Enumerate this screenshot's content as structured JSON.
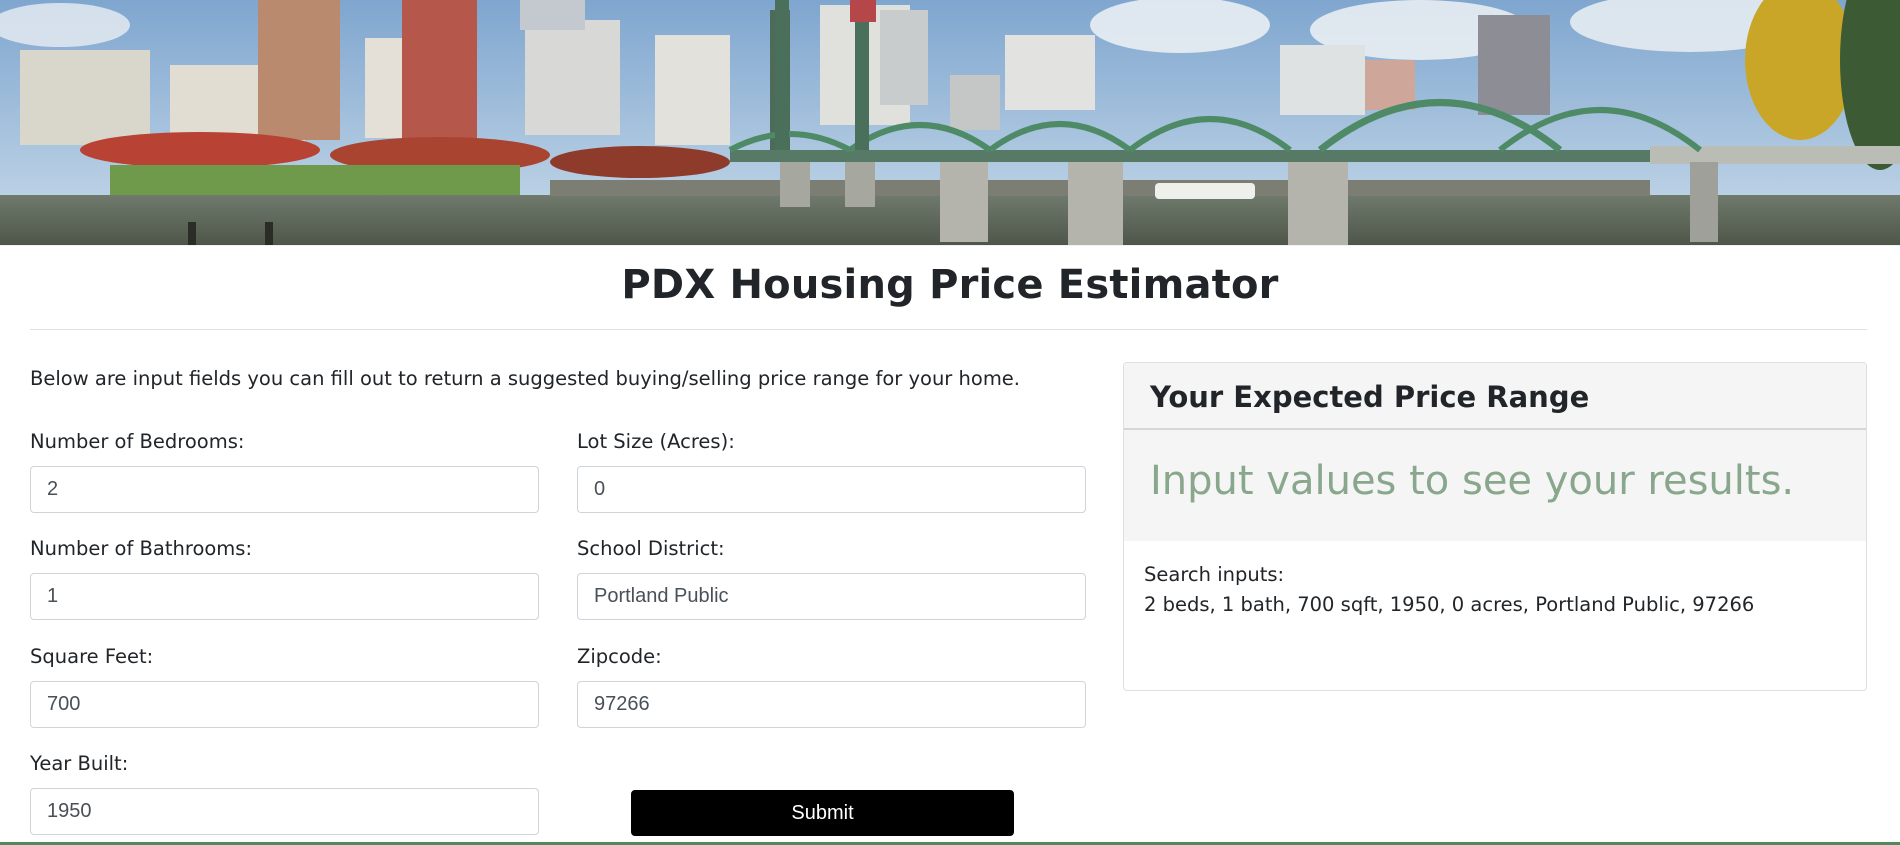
{
  "page": {
    "title": "PDX Housing Price Estimator",
    "intro": "Below are input fields you can fill out to return a suggested buying/selling price range for your home."
  },
  "form": {
    "bedrooms": {
      "label": "Number of Bedrooms:",
      "value": "2"
    },
    "bathrooms": {
      "label": "Number of Bathrooms:",
      "value": "1"
    },
    "square_feet": {
      "label": "Square Feet:",
      "value": "700"
    },
    "year_built": {
      "label": "Year Built:",
      "value": "1950"
    },
    "lot_size": {
      "label": "Lot Size (Acres):",
      "value": "0"
    },
    "school_district": {
      "label": "School District:",
      "value": "Portland Public"
    },
    "zipcode": {
      "label": "Zipcode:",
      "value": "97266"
    },
    "submit_label": "Submit"
  },
  "results": {
    "title": "Your Expected Price Range",
    "message": "Input values to see your results.",
    "search_label": "Search inputs:",
    "search_summary": "2 beds, 1 bath, 700 sqft, 1950, 0 acres, Portland Public, 97266"
  },
  "colors": {
    "result_text": "#89a78c",
    "submit_bg": "#000000",
    "card_header_bg": "#f5f5f5"
  }
}
